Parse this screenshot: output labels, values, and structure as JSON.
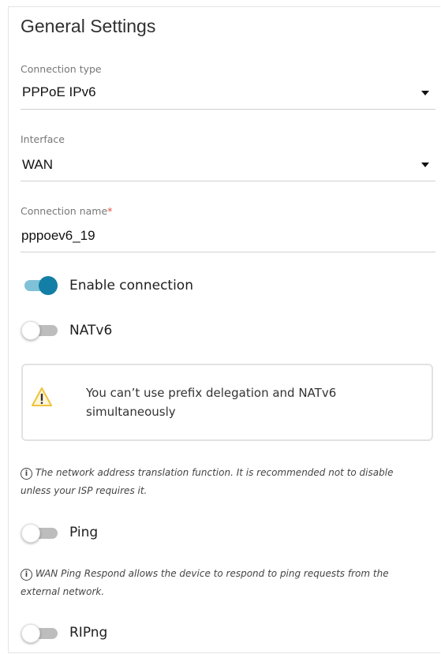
{
  "title": "General Settings",
  "connection_type": {
    "label": "Connection type",
    "value": "PPPoE IPv6"
  },
  "interface": {
    "label": "Interface",
    "value": "WAN"
  },
  "connection_name": {
    "label": "Connection name",
    "required_mark": "*",
    "value": "pppoev6_19"
  },
  "toggles": {
    "enable_connection": {
      "label": "Enable connection",
      "state": "on"
    },
    "natv6": {
      "label": "NATv6",
      "state": "off"
    },
    "ping": {
      "label": "Ping",
      "state": "off"
    },
    "ripng": {
      "label": "RIPng",
      "state": "off"
    }
  },
  "warning": {
    "line1": "You can’t use prefix delegation and NATv6",
    "line2": "simultaneously"
  },
  "notes": {
    "nat": {
      "line1": "The network address translation function. It is recommended not to disable",
      "line2": "unless your ISP requires it."
    },
    "ping": {
      "line1": "WAN Ping Respond allows the device to respond to ping requests from the",
      "line2": "external network."
    }
  },
  "colors": {
    "accent": "#137fa6",
    "accent_track": "#7fc1d6",
    "warning_icon": "#f0c23a",
    "required": "#e84b3c"
  }
}
